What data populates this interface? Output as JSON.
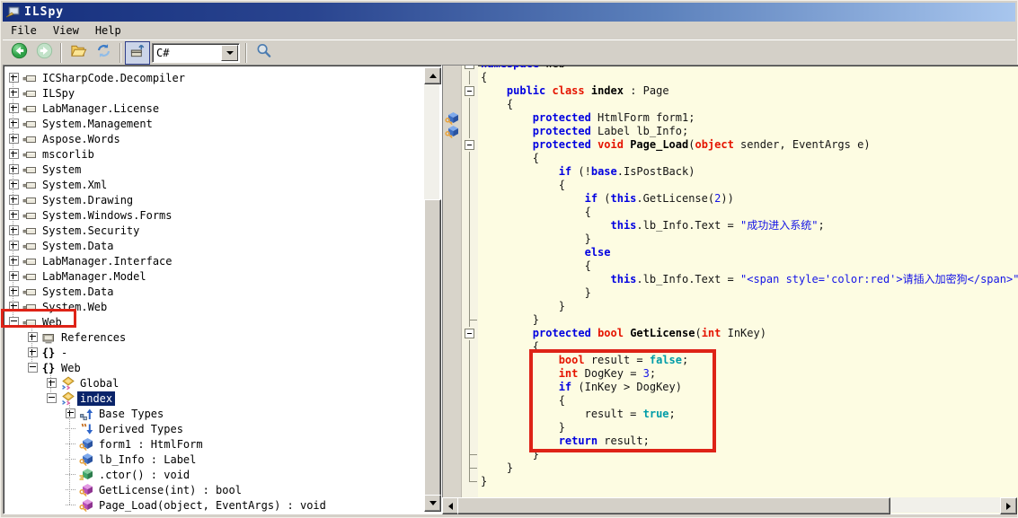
{
  "window": {
    "title": "ILSpy"
  },
  "menu": {
    "items": [
      "File",
      "View",
      "Help"
    ]
  },
  "toolbar": {
    "buttons": [
      {
        "name": "back",
        "icon": "back-icon",
        "enabled": true
      },
      {
        "name": "forward",
        "icon": "forward-icon",
        "enabled": false
      },
      {
        "name": "open-file",
        "icon": "open-file-icon",
        "enabled": true
      },
      {
        "name": "refresh",
        "icon": "refresh-icon",
        "enabled": true
      },
      {
        "name": "assembly-import",
        "icon": "assembly-import-icon",
        "enabled": true,
        "pressed": true
      }
    ],
    "language_selector": {
      "value": "C#"
    },
    "search": {
      "icon": "search-icon"
    }
  },
  "colors": {
    "selection_bg": "#0A246A",
    "code_bg": "#FDFCE2",
    "keyword": "#0000E0",
    "type_keyword": "#E51400",
    "string_number": "#1414E6",
    "bool_literal": "#009CA8",
    "annotation_red": "#DE2317",
    "titlebar_left": "#16307E",
    "titlebar_right": "#A8C6EE"
  },
  "annotations": {
    "tree_highlight_target": "Web",
    "code_highlight_target": "GetLicense method body"
  },
  "tree": {
    "items": [
      {
        "level": 0,
        "icon": "assembly",
        "expander": "plus",
        "label": "ICSharpCode.Decompiler"
      },
      {
        "level": 0,
        "icon": "assembly",
        "expander": "plus",
        "label": "ILSpy"
      },
      {
        "level": 0,
        "icon": "assembly",
        "expander": "plus",
        "label": "LabManager.License"
      },
      {
        "level": 0,
        "icon": "assembly",
        "expander": "plus",
        "label": "System.Management"
      },
      {
        "level": 0,
        "icon": "assembly",
        "expander": "plus",
        "label": "Aspose.Words"
      },
      {
        "level": 0,
        "icon": "assembly",
        "expander": "plus",
        "label": "mscorlib"
      },
      {
        "level": 0,
        "icon": "assembly",
        "expander": "plus",
        "label": "System"
      },
      {
        "level": 0,
        "icon": "assembly",
        "expander": "plus",
        "label": "System.Xml"
      },
      {
        "level": 0,
        "icon": "assembly",
        "expander": "plus",
        "label": "System.Drawing"
      },
      {
        "level": 0,
        "icon": "assembly",
        "expander": "plus",
        "label": "System.Windows.Forms"
      },
      {
        "level": 0,
        "icon": "assembly",
        "expander": "plus",
        "label": "System.Security"
      },
      {
        "level": 0,
        "icon": "assembly",
        "expander": "plus",
        "label": "System.Data"
      },
      {
        "level": 0,
        "icon": "assembly",
        "expander": "plus",
        "label": "LabManager.Interface"
      },
      {
        "level": 0,
        "icon": "assembly",
        "expander": "plus",
        "label": "LabManager.Model"
      },
      {
        "level": 0,
        "icon": "assembly",
        "expander": "plus",
        "label": "System.Data"
      },
      {
        "level": 0,
        "icon": "assembly",
        "expander": "plus",
        "label": "System.Web"
      },
      {
        "level": 0,
        "icon": "assembly",
        "expander": "minus",
        "label": "Web",
        "highlighted": true
      },
      {
        "level": 1,
        "icon": "references",
        "expander": "plus",
        "label": "References"
      },
      {
        "level": 1,
        "icon": "namespace",
        "expander": "plus",
        "label": "-"
      },
      {
        "level": 1,
        "icon": "namespace",
        "expander": "minus",
        "label": "Web"
      },
      {
        "level": 2,
        "icon": "class",
        "expander": "plus",
        "label": "Global"
      },
      {
        "level": 2,
        "icon": "class",
        "expander": "minus",
        "label": "index",
        "selected": true
      },
      {
        "level": 3,
        "icon": "base-types",
        "expander": "plus",
        "label": "Base Types"
      },
      {
        "level": 3,
        "icon": "derived-types",
        "expander": "none",
        "label": "Derived Types"
      },
      {
        "level": 3,
        "icon": "field",
        "expander": "none",
        "label": "form1 : HtmlForm"
      },
      {
        "level": 3,
        "icon": "field",
        "expander": "none",
        "label": "lb_Info : Label"
      },
      {
        "level": 3,
        "icon": "ctor",
        "expander": "none",
        "label": ".ctor() : void"
      },
      {
        "level": 3,
        "icon": "method",
        "expander": "none",
        "label": "GetLicense(int) : bool"
      },
      {
        "level": 3,
        "icon": "method",
        "expander": "none",
        "label": "Page_Load(object, EventArgs) : void"
      }
    ]
  },
  "code": {
    "lines": [
      {
        "fold": "minus",
        "tokens": [
          [
            "kw",
            "namespace"
          ],
          [
            "pln",
            " Web"
          ]
        ]
      },
      {
        "fold": "line",
        "tokens": [
          [
            "pln",
            "{"
          ]
        ]
      },
      {
        "fold": "minus",
        "tokens": [
          [
            "pln",
            "    "
          ],
          [
            "kw",
            "public"
          ],
          [
            "pln",
            " "
          ],
          [
            "ty",
            "class"
          ],
          [
            "pln",
            " "
          ],
          [
            "dcl",
            "index"
          ],
          [
            "pln",
            " : Page"
          ]
        ]
      },
      {
        "fold": "line",
        "tokens": [
          [
            "pln",
            "    {"
          ]
        ]
      },
      {
        "fold": "line",
        "gutter": "field",
        "tokens": [
          [
            "pln",
            "        "
          ],
          [
            "kw",
            "protected"
          ],
          [
            "pln",
            " HtmlForm form1;"
          ]
        ]
      },
      {
        "fold": "line",
        "gutter": "field",
        "tokens": [
          [
            "pln",
            "        "
          ],
          [
            "kw",
            "protected"
          ],
          [
            "pln",
            " Label lb_Info;"
          ]
        ]
      },
      {
        "fold": "minus",
        "tokens": [
          [
            "pln",
            "        "
          ],
          [
            "kw",
            "protected"
          ],
          [
            "pln",
            " "
          ],
          [
            "ty",
            "void"
          ],
          [
            "pln",
            " "
          ],
          [
            "dcl",
            "Page_Load"
          ],
          [
            "pln",
            "("
          ],
          [
            "ty",
            "object"
          ],
          [
            "pln",
            " sender, EventArgs e)"
          ]
        ]
      },
      {
        "fold": "line",
        "tokens": [
          [
            "pln",
            "        {"
          ]
        ]
      },
      {
        "fold": "line",
        "tokens": [
          [
            "pln",
            "            "
          ],
          [
            "kw",
            "if"
          ],
          [
            "pln",
            " (!"
          ],
          [
            "kwb",
            "base"
          ],
          [
            "pln",
            ".IsPostBack)"
          ]
        ]
      },
      {
        "fold": "line",
        "tokens": [
          [
            "pln",
            "            {"
          ]
        ]
      },
      {
        "fold": "line",
        "tokens": [
          [
            "pln",
            "                "
          ],
          [
            "kw",
            "if"
          ],
          [
            "pln",
            " ("
          ],
          [
            "kwb",
            "this"
          ],
          [
            "pln",
            ".GetLicense("
          ],
          [
            "num",
            "2"
          ],
          [
            "pln",
            "))"
          ]
        ]
      },
      {
        "fold": "line",
        "tokens": [
          [
            "pln",
            "                {"
          ]
        ]
      },
      {
        "fold": "line",
        "tokens": [
          [
            "pln",
            "                    "
          ],
          [
            "kwb",
            "this"
          ],
          [
            "pln",
            ".lb_Info.Text = "
          ],
          [
            "str",
            "\"成功进入系统\""
          ],
          [
            "pln",
            ";"
          ]
        ]
      },
      {
        "fold": "line",
        "tokens": [
          [
            "pln",
            "                }"
          ]
        ]
      },
      {
        "fold": "line",
        "tokens": [
          [
            "pln",
            "                "
          ],
          [
            "kw",
            "else"
          ]
        ]
      },
      {
        "fold": "line",
        "tokens": [
          [
            "pln",
            "                {"
          ]
        ]
      },
      {
        "fold": "line",
        "tokens": [
          [
            "pln",
            "                    "
          ],
          [
            "kwb",
            "this"
          ],
          [
            "pln",
            ".lb_Info.Text = "
          ],
          [
            "str",
            "\"<span style='color:red'>请插入加密狗</span>\""
          ],
          [
            "pln",
            ";"
          ]
        ]
      },
      {
        "fold": "line",
        "tokens": [
          [
            "pln",
            "                }"
          ]
        ]
      },
      {
        "fold": "line",
        "tokens": [
          [
            "pln",
            "            }"
          ]
        ]
      },
      {
        "fold": "tick",
        "tokens": [
          [
            "pln",
            "        }"
          ]
        ]
      },
      {
        "fold": "minus",
        "tokens": [
          [
            "pln",
            "        "
          ],
          [
            "kw",
            "protected"
          ],
          [
            "pln",
            " "
          ],
          [
            "ty",
            "bool"
          ],
          [
            "pln",
            " "
          ],
          [
            "dcl",
            "GetLicense"
          ],
          [
            "pln",
            "("
          ],
          [
            "ty",
            "int"
          ],
          [
            "pln",
            " InKey)"
          ]
        ]
      },
      {
        "fold": "line",
        "tokens": [
          [
            "pln",
            "        {"
          ]
        ]
      },
      {
        "fold": "line",
        "tokens": [
          [
            "pln",
            "            "
          ],
          [
            "ty",
            "bool"
          ],
          [
            "pln",
            " result = "
          ],
          [
            "lit",
            "false"
          ],
          [
            "pln",
            ";"
          ]
        ]
      },
      {
        "fold": "line",
        "tokens": [
          [
            "pln",
            "            "
          ],
          [
            "ty",
            "int"
          ],
          [
            "pln",
            " DogKey = "
          ],
          [
            "num",
            "3"
          ],
          [
            "pln",
            ";"
          ]
        ]
      },
      {
        "fold": "line",
        "tokens": [
          [
            "pln",
            "            "
          ],
          [
            "kw",
            "if"
          ],
          [
            "pln",
            " (InKey > DogKey)"
          ]
        ]
      },
      {
        "fold": "line",
        "tokens": [
          [
            "pln",
            "            {"
          ]
        ]
      },
      {
        "fold": "line",
        "tokens": [
          [
            "pln",
            "                result = "
          ],
          [
            "lit",
            "true"
          ],
          [
            "pln",
            ";"
          ]
        ]
      },
      {
        "fold": "line",
        "tokens": [
          [
            "pln",
            "            }"
          ]
        ]
      },
      {
        "fold": "line",
        "tokens": [
          [
            "pln",
            "            "
          ],
          [
            "kw",
            "return"
          ],
          [
            "pln",
            " result;"
          ]
        ]
      },
      {
        "fold": "tick",
        "tokens": [
          [
            "pln",
            "        }"
          ]
        ]
      },
      {
        "fold": "tick",
        "tokens": [
          [
            "pln",
            "    }"
          ]
        ]
      },
      {
        "fold": "end",
        "tokens": [
          [
            "pln",
            "}"
          ]
        ]
      }
    ]
  }
}
